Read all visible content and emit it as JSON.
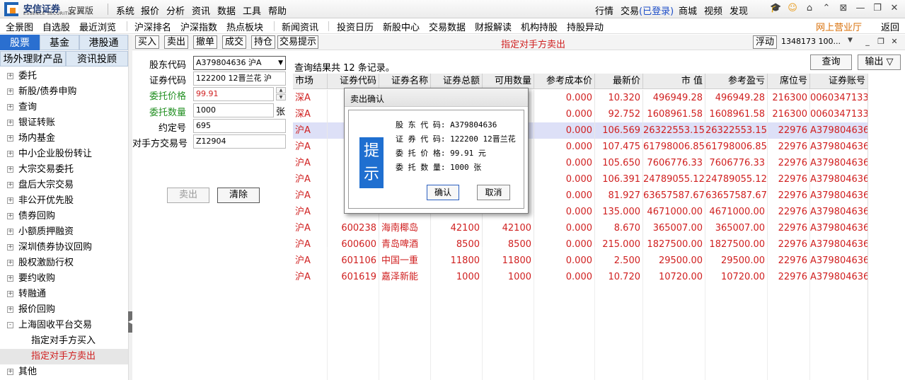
{
  "app": {
    "brand": "安信证券",
    "brand_sub": "ESSENCE SECURITIES",
    "edition": "安翼版"
  },
  "menu": [
    "系统",
    "报价",
    "分析",
    "资讯",
    "数据",
    "工具",
    "帮助"
  ],
  "menu_right": {
    "market": "行情",
    "trade": "交易",
    "logged_in": "(已登录)",
    "mall": "商城",
    "video": "视频",
    "discover": "发现"
  },
  "nav": [
    "全景图",
    "自选股",
    "最近浏览",
    "沪深排名",
    "沪深指数",
    "热点板块",
    "新闻资讯",
    "投资日历",
    "新股中心",
    "交易数据",
    "财报解读",
    "机构持股",
    "持股异动"
  ],
  "nav_right": {
    "online_office": "网上营业厅",
    "back": "返回"
  },
  "left_tabs": [
    "股票",
    "基金",
    "港股通",
    "场外理财产品",
    "资讯投顾"
  ],
  "tree": [
    {
      "label": "委托",
      "box": "+"
    },
    {
      "label": "新股/债券申购",
      "box": "+"
    },
    {
      "label": "查询",
      "box": "+"
    },
    {
      "label": "银证转账",
      "box": "+"
    },
    {
      "label": "场内基金",
      "box": "+"
    },
    {
      "label": "中小企业股份转让",
      "box": "+"
    },
    {
      "label": "大宗交易委托",
      "box": "+"
    },
    {
      "label": "盘后大宗交易",
      "box": "+"
    },
    {
      "label": "非公开优先股",
      "box": "+"
    },
    {
      "label": "债券回购",
      "box": "+"
    },
    {
      "label": "小额质押融资",
      "box": "+"
    },
    {
      "label": "深圳债券协议回购",
      "box": "+"
    },
    {
      "label": "股权激励行权",
      "box": "+"
    },
    {
      "label": "要约收购",
      "box": "+"
    },
    {
      "label": "转融通",
      "box": "+"
    },
    {
      "label": "报价回购",
      "box": "+"
    },
    {
      "label": "上海固收平台交易",
      "box": "-"
    },
    {
      "label": "指定对手方买入",
      "box": ""
    },
    {
      "label": "指定对手方卖出",
      "box": ""
    },
    {
      "label": "其他",
      "box": "+"
    }
  ],
  "toolbar": {
    "buttons": [
      "买入",
      "卖出",
      "撤单",
      "成交",
      "持仓",
      "交易提示"
    ],
    "title": "指定对手方卖出",
    "float_label": "浮动",
    "account": "1348173 100...",
    "dropdown": "▼",
    "win_min": "_",
    "win_restore": "❐",
    "win_close": "✕"
  },
  "form": {
    "holder_label": "股东代码",
    "holder_value": "A379804636 沪A",
    "code_label": "证券代码",
    "code_value": "122200 12晋兰花 沪",
    "price_label": "委托价格",
    "price_value": "99.91",
    "qty_label": "委托数量",
    "qty_value": "1000",
    "qty_unit": "张",
    "agreement_label": "约定号",
    "agreement_value": "695",
    "counterparty_label": "对手方交易号",
    "counterparty_value": "Z12904",
    "sell_button": "卖出",
    "clear_button": "清除"
  },
  "results": {
    "count_text": "查询结果共 12 条记录。",
    "query_button": "查询",
    "output_button": "输出 ▽",
    "columns": [
      "市场",
      "证券代码",
      "证券名称",
      "证券总额",
      "可用数量",
      "参考成本价",
      "最新价",
      "市 值",
      "参考盈亏",
      "席位号",
      "证券账号"
    ],
    "rows": [
      [
        "深A",
        "",
        "",
        "",
        "",
        "0.000",
        "10.320",
        "496949.28",
        "496949.28",
        "216300",
        "0060347133"
      ],
      [
        "深A",
        "",
        "",
        "",
        "",
        "0.000",
        "92.752",
        "1608961.58",
        "1608961.58",
        "216300",
        "0060347133"
      ],
      [
        "沪A",
        "",
        "",
        "",
        "",
        "0.000",
        "106.569",
        "26322553.15",
        "26322553.15",
        "22976",
        "A379804636"
      ],
      [
        "沪A",
        "",
        "",
        "",
        "",
        "0.000",
        "107.475",
        "61798006.85",
        "61798006.85",
        "22976",
        "A379804636"
      ],
      [
        "沪A",
        "",
        "",
        "",
        "",
        "0.000",
        "105.650",
        "7606776.33",
        "7606776.33",
        "22976",
        "A379804636"
      ],
      [
        "沪A",
        "",
        "",
        "",
        "",
        "0.000",
        "106.391",
        "24789055.12",
        "24789055.12",
        "22976",
        "A379804636"
      ],
      [
        "沪A",
        "",
        "",
        "",
        "",
        "0.000",
        "81.927",
        "63657587.67",
        "63657587.67",
        "22976",
        "A379804636"
      ],
      [
        "沪A",
        "",
        "",
        "",
        "",
        "0.000",
        "135.000",
        "4671000.00",
        "4671000.00",
        "22976",
        "A379804636"
      ],
      [
        "沪A",
        "600238",
        "海南椰岛",
        "42100",
        "42100",
        "0.000",
        "8.670",
        "365007.00",
        "365007.00",
        "22976",
        "A379804636"
      ],
      [
        "沪A",
        "600600",
        "青岛啤酒",
        "8500",
        "8500",
        "0.000",
        "215.000",
        "1827500.00",
        "1827500.00",
        "22976",
        "A379804636"
      ],
      [
        "沪A",
        "601106",
        "中国一重",
        "11800",
        "11800",
        "0.000",
        "2.500",
        "29500.00",
        "29500.00",
        "22976",
        "A379804636"
      ],
      [
        "沪A",
        "601619",
        "嘉泽新能",
        "1000",
        "1000",
        "0.000",
        "10.720",
        "10720.00",
        "10720.00",
        "22976",
        "A379804636"
      ]
    ]
  },
  "dialog": {
    "title": "卖出确认",
    "badge": "提示",
    "holder_line": "股 东 代 码: A379804636",
    "code_line": "证 券 代 码: 122200   12晋兰花",
    "price_line": "委 托 价 格: 99.91 元",
    "qty_line": "委 托 数 量: 1000 张",
    "confirm": "确认",
    "cancel": "取消"
  },
  "colors": {
    "red": "#d02020",
    "blue": "#1e4fc9",
    "tab_active": "#2a6fd0",
    "highlight_row": "#dde0f7"
  }
}
